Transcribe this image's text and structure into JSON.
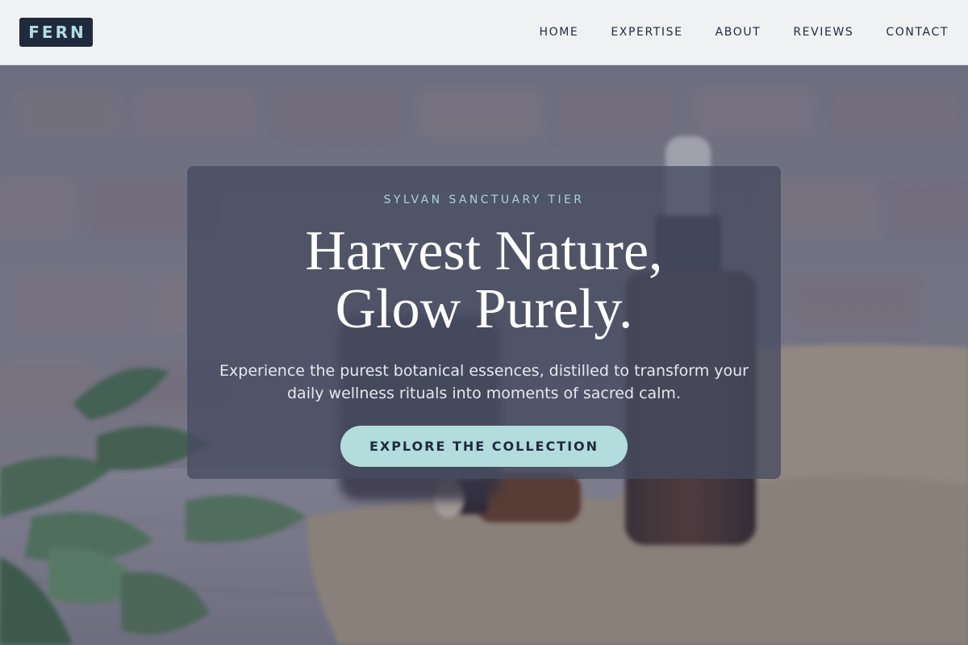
{
  "header": {
    "logo": "FERN",
    "nav": [
      "HOME",
      "EXPERTISE",
      "ABOUT",
      "REVIEWS",
      "CONTACT"
    ]
  },
  "hero": {
    "eyebrow": "SYLVAN SANCTUARY TIER",
    "headline_line1": "Harvest Nature,",
    "headline_line2": "Glow Purely.",
    "description": "Experience the purest botanical essences, distilled to transform your daily wellness rituals into moments of sacred calm.",
    "cta_label": "EXPLORE THE COLLECTION"
  },
  "colors": {
    "logo_bg": "#1f2a3d",
    "accent": "#b3dcdd",
    "eyebrow": "#a8d5d8",
    "header_bg": "#f0f1f3"
  }
}
